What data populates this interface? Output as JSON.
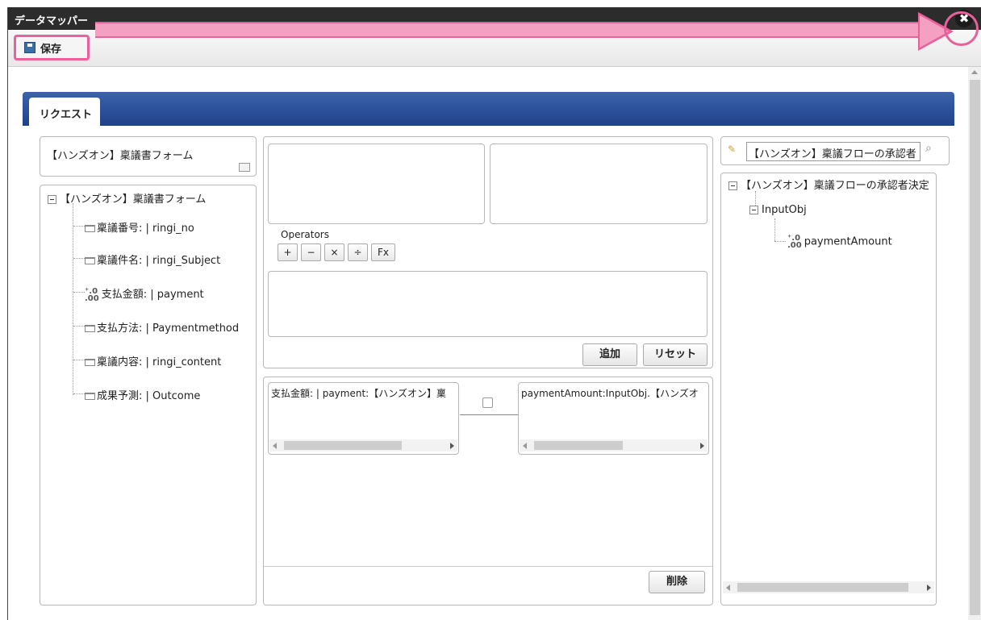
{
  "window": {
    "title": "データマッパー"
  },
  "toolbar": {
    "save_label": "保存"
  },
  "tabs": [
    {
      "label": "リクエスト"
    }
  ],
  "left": {
    "form_title": "【ハンズオン】稟議書フォーム",
    "tree_root": "【ハンズオン】稟議書フォーム",
    "items": [
      {
        "label": "稟議番号: | ringi_no",
        "icon": "field-icon"
      },
      {
        "label": "稟議件名: | ringi_Subject",
        "icon": "field-icon"
      },
      {
        "label": "支払金額: | payment",
        "icon": "number-icon"
      },
      {
        "label": "支払方法: | Paymentmethod",
        "icon": "field-icon"
      },
      {
        "label": "稟議内容: | ringi_content",
        "icon": "field-icon"
      },
      {
        "label": "成果予測: | Outcome",
        "icon": "field-icon"
      }
    ]
  },
  "middle": {
    "operators_label": "Operators",
    "operators": [
      "+",
      "−",
      "×",
      "÷",
      "Fx"
    ],
    "add_label": "追加",
    "reset_label": "リセット",
    "mapping_left": "支払金額: | payment:【ハンズオン】稟",
    "mapping_right": "paymentAmount:InputObj.【ハンズオ",
    "delete_label": "削除"
  },
  "right": {
    "search_value": "【ハンズオン】稟議フローの承認者",
    "tree_root": "【ハンズオン】稟議フローの承認者決定",
    "child": "InputObj",
    "leaf": "paymentAmount"
  }
}
